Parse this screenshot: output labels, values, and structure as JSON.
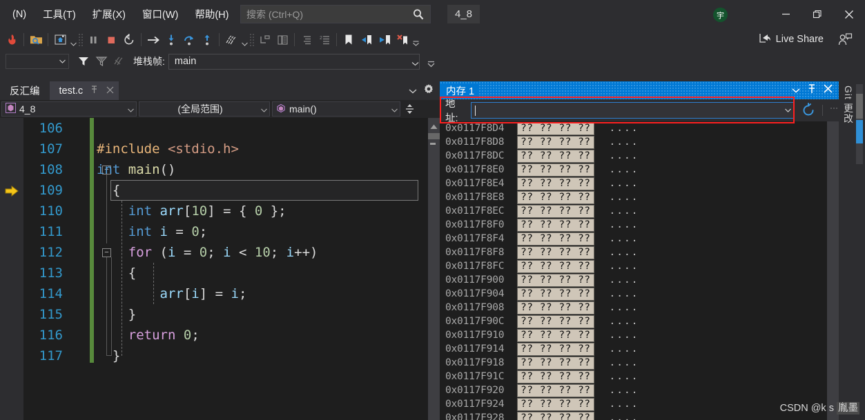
{
  "window": {
    "title_chip": "4_8",
    "avatar_initial": "宇",
    "minimize_label": "最小化",
    "restore_label": "还原",
    "close_label": "关闭"
  },
  "menubar": {
    "items": [
      {
        "label": "(N)",
        "name": "menu-new"
      },
      {
        "label": "工具(T)",
        "name": "menu-tools"
      },
      {
        "label": "扩展(X)",
        "name": "menu-extensions"
      },
      {
        "label": "窗口(W)",
        "name": "menu-window"
      },
      {
        "label": "帮助(H)",
        "name": "menu-help"
      }
    ]
  },
  "search": {
    "placeholder": "搜索 (Ctrl+Q)",
    "value": ""
  },
  "toolbar": {
    "live_share_label": "Live Share",
    "icons": [
      "hot-reload-icon",
      "open-folder-search-icon",
      "attach-process-icon",
      "pause-icon",
      "stop-icon",
      "restart-icon",
      "continue-arrow-icon",
      "step-into-icon",
      "step-over-icon",
      "step-out-icon",
      "threads-icon",
      "show-next-statement-icon",
      "compare-icon",
      "indent-icon",
      "outdent-icon",
      "bookmark-icon",
      "prev-bookmark-icon",
      "next-bookmark-icon",
      "clear-bookmark-icon"
    ]
  },
  "debug_bar": {
    "stack_frame_label": "堆栈帧:",
    "stack_frame_value": "main",
    "thread_value": ""
  },
  "editor_dock": {
    "disassembly_label": "反汇编",
    "tab": {
      "label": "test.c",
      "pin_glyph": "⚲",
      "close_glyph": "✕"
    }
  },
  "navigation": {
    "project": "4_8",
    "scope": "(全局范围)",
    "member": "main()"
  },
  "code": {
    "current_line": 109,
    "lines": [
      {
        "num": 106,
        "tokens": []
      },
      {
        "num": 107,
        "tokens": [
          {
            "t": "#include ",
            "c": "k-pre"
          },
          {
            "t": "<stdio.h>",
            "c": "k-str"
          }
        ]
      },
      {
        "num": 108,
        "tokens": [
          {
            "t": "int ",
            "c": "k-type"
          },
          {
            "t": "main",
            "c": "k-fn"
          },
          {
            "t": "()",
            "c": "k-pun"
          }
        ]
      },
      {
        "num": 109,
        "tokens": [
          {
            "t": "{",
            "c": "k-pun"
          }
        ]
      },
      {
        "num": 110,
        "tokens": [
          {
            "t": "    ",
            "c": "k-pun"
          },
          {
            "t": "int ",
            "c": "k-type"
          },
          {
            "t": "arr",
            "c": "k-var"
          },
          {
            "t": "[",
            "c": "k-pun"
          },
          {
            "t": "10",
            "c": "k-num"
          },
          {
            "t": "] = { ",
            "c": "k-pun"
          },
          {
            "t": "0",
            "c": "k-num"
          },
          {
            "t": " };",
            "c": "k-pun"
          }
        ]
      },
      {
        "num": 111,
        "tokens": [
          {
            "t": "    ",
            "c": "k-pun"
          },
          {
            "t": "int ",
            "c": "k-type"
          },
          {
            "t": "i",
            "c": "k-var"
          },
          {
            "t": " = ",
            "c": "k-pun"
          },
          {
            "t": "0",
            "c": "k-num"
          },
          {
            "t": ";",
            "c": "k-pun"
          }
        ]
      },
      {
        "num": 112,
        "tokens": [
          {
            "t": "    ",
            "c": "k-pun"
          },
          {
            "t": "for",
            "c": "k-ctrl"
          },
          {
            "t": " (",
            "c": "k-pun"
          },
          {
            "t": "i",
            "c": "k-var"
          },
          {
            "t": " = ",
            "c": "k-pun"
          },
          {
            "t": "0",
            "c": "k-num"
          },
          {
            "t": "; ",
            "c": "k-pun"
          },
          {
            "t": "i",
            "c": "k-var"
          },
          {
            "t": " < ",
            "c": "k-pun"
          },
          {
            "t": "10",
            "c": "k-num"
          },
          {
            "t": "; ",
            "c": "k-pun"
          },
          {
            "t": "i",
            "c": "k-var"
          },
          {
            "t": "++)",
            "c": "k-pun"
          }
        ]
      },
      {
        "num": 113,
        "tokens": [
          {
            "t": "    {",
            "c": "k-pun"
          }
        ]
      },
      {
        "num": 114,
        "tokens": [
          {
            "t": "        ",
            "c": "k-pun"
          },
          {
            "t": "arr",
            "c": "k-var"
          },
          {
            "t": "[",
            "c": "k-pun"
          },
          {
            "t": "i",
            "c": "k-var"
          },
          {
            "t": "] = ",
            "c": "k-pun"
          },
          {
            "t": "i",
            "c": "k-var"
          },
          {
            "t": ";",
            "c": "k-pun"
          }
        ]
      },
      {
        "num": 115,
        "tokens": [
          {
            "t": "    }",
            "c": "k-pun"
          }
        ]
      },
      {
        "num": 116,
        "tokens": [
          {
            "t": "    ",
            "c": "k-pun"
          },
          {
            "t": "return",
            "c": "k-ctrl"
          },
          {
            "t": " ",
            "c": "k-pun"
          },
          {
            "t": "0",
            "c": "k-num"
          },
          {
            "t": ";",
            "c": "k-pun"
          }
        ]
      },
      {
        "num": 117,
        "tokens": [
          {
            "t": "}",
            "c": "k-pun"
          }
        ]
      }
    ]
  },
  "memory_window": {
    "title": "内存 1",
    "address_label": "地址:",
    "address_value": "",
    "dropdown_glyph": "▾",
    "pin_glyph": "⚲",
    "close_glyph": "✕",
    "refresh_name": "refresh-icon",
    "rows": [
      {
        "address": "0x0117F8D4",
        "hex": "?? ?? ?? ??",
        "ascii": "...."
      },
      {
        "address": "0x0117F8D8",
        "hex": "?? ?? ?? ??",
        "ascii": "...."
      },
      {
        "address": "0x0117F8DC",
        "hex": "?? ?? ?? ??",
        "ascii": "...."
      },
      {
        "address": "0x0117F8E0",
        "hex": "?? ?? ?? ??",
        "ascii": "...."
      },
      {
        "address": "0x0117F8E4",
        "hex": "?? ?? ?? ??",
        "ascii": "...."
      },
      {
        "address": "0x0117F8E8",
        "hex": "?? ?? ?? ??",
        "ascii": "...."
      },
      {
        "address": "0x0117F8EC",
        "hex": "?? ?? ?? ??",
        "ascii": "...."
      },
      {
        "address": "0x0117F8F0",
        "hex": "?? ?? ?? ??",
        "ascii": "...."
      },
      {
        "address": "0x0117F8F4",
        "hex": "?? ?? ?? ??",
        "ascii": "...."
      },
      {
        "address": "0x0117F8F8",
        "hex": "?? ?? ?? ??",
        "ascii": "...."
      },
      {
        "address": "0x0117F8FC",
        "hex": "?? ?? ?? ??",
        "ascii": "...."
      },
      {
        "address": "0x0117F900",
        "hex": "?? ?? ?? ??",
        "ascii": "...."
      },
      {
        "address": "0x0117F904",
        "hex": "?? ?? ?? ??",
        "ascii": "...."
      },
      {
        "address": "0x0117F908",
        "hex": "?? ?? ?? ??",
        "ascii": "...."
      },
      {
        "address": "0x0117F90C",
        "hex": "?? ?? ?? ??",
        "ascii": "...."
      },
      {
        "address": "0x0117F910",
        "hex": "?? ?? ?? ??",
        "ascii": "...."
      },
      {
        "address": "0x0117F914",
        "hex": "?? ?? ?? ??",
        "ascii": "...."
      },
      {
        "address": "0x0117F918",
        "hex": "?? ?? ?? ??",
        "ascii": "...."
      },
      {
        "address": "0x0117F91C",
        "hex": "?? ?? ?? ??",
        "ascii": "...."
      },
      {
        "address": "0x0117F920",
        "hex": "?? ?? ?? ??",
        "ascii": "...."
      },
      {
        "address": "0x0117F924",
        "hex": "?? ?? ?? ??",
        "ascii": "...."
      },
      {
        "address": "0x0117F928",
        "hex": "?? ?? ?? ??",
        "ascii": "...."
      }
    ]
  },
  "git_panel": {
    "label": "Git 更改"
  },
  "watermark": {
    "prefix": "CSDN @k s ",
    "name": "胤墨"
  },
  "colors": {
    "accent_blue": "#0078d4",
    "highlight_red": "#ff2020",
    "change_bar_green": "#57893b",
    "line_number": "#3399cc",
    "mem_hex_bg": "#cfc6b8"
  }
}
